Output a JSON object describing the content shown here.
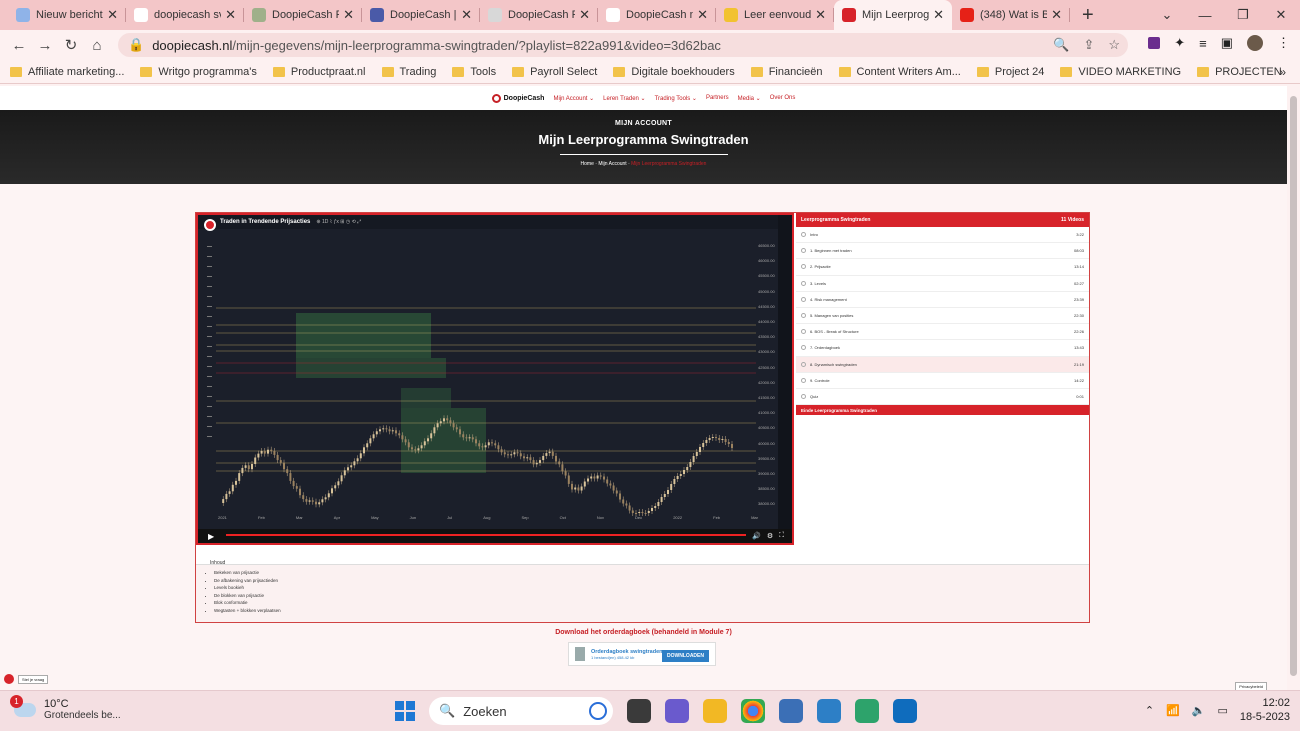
{
  "browser": {
    "tabs": [
      {
        "title": "Nieuw bericht",
        "fav": "#8fb3e8"
      },
      {
        "title": "doopiecash sv",
        "fav": "#ffffff"
      },
      {
        "title": "DoopieCash R",
        "fav": "#9fb08a"
      },
      {
        "title": "DoopieCash |",
        "fav": "#4a5aa8"
      },
      {
        "title": "DoopieCash R",
        "fav": "#d8d8d8"
      },
      {
        "title": "DoopieCash n",
        "fav": "#ffffff"
      },
      {
        "title": "Leer eenvoudi",
        "fav": "#f2c230"
      },
      {
        "title": "Mijn Leerprog",
        "fav": "#d7232a",
        "active": true
      },
      {
        "title": "(348) Wat is B",
        "fav": "#e62117"
      }
    ],
    "url_host": "doopiecash.nl",
    "url_path": "/mijn-gegevens/mijn-leerprogramma-swingtraden/?playlist=822a991&video=3d62bac",
    "bookmarks": [
      "Affiliate marketing...",
      "Writgo programma's",
      "Productpraat.nl",
      "Trading",
      "Tools",
      "Payroll Select",
      "Digitale boekhouders",
      "Financieën",
      "Content Writers Am...",
      "Project 24",
      "VIDEO MARKETING",
      "PROJECTEN"
    ]
  },
  "site": {
    "logo": "DoopieCash",
    "nav": [
      "Mijn Account ⌄",
      "Leren Traden ⌄",
      "Trading Tools ⌄",
      "Partners",
      "Media ⌄",
      "Over Ons"
    ],
    "hero_small": "MIJN ACCOUNT",
    "hero_title": "Mijn Leerprogramma Swingtraden",
    "crumb_home": "Home",
    "crumb_account": "Mijn Account",
    "crumb_current": "Mijn Leerprogramma Swingtraden"
  },
  "video": {
    "title": "Traden in Trendende Prijsacties",
    "y_ticks": [
      "46500.00",
      "46000.00",
      "45500.00",
      "45000.00",
      "44500.00",
      "44000.00",
      "43500.00",
      "43000.00",
      "42500.00",
      "42000.00",
      "41500.00",
      "41000.00",
      "40500.00",
      "40000.00",
      "39500.00",
      "39000.00",
      "38500.00",
      "38000.00"
    ],
    "x_ticks": [
      "2021",
      "Feb",
      "Mar",
      "Apr",
      "May",
      "Jun",
      "Jul",
      "Aug",
      "Sep",
      "Oct",
      "Nov",
      "Dec",
      "2022",
      "Feb",
      "Mar"
    ]
  },
  "playlist": {
    "title": "Leerprogramma Swingtraden",
    "count": "11 Videos",
    "items": [
      {
        "title": "Intro",
        "time": "3:22"
      },
      {
        "title": "1. Beginnen met traden",
        "time": "08:03"
      },
      {
        "title": "2. Prijsactie",
        "time": "13:14"
      },
      {
        "title": "3. Levels",
        "time": "02:27"
      },
      {
        "title": "4. Risk management",
        "time": "23:39"
      },
      {
        "title": "5. Managen van posities",
        "time": "22:30"
      },
      {
        "title": "6. BOS - Break of Structure",
        "time": "22:26"
      },
      {
        "title": "7. Orderdagboek",
        "time": "13:43"
      },
      {
        "title": "8. Dynamisch swingtraden",
        "time": "21:19",
        "active": true
      },
      {
        "title": "9. Controle",
        "time": "14:22"
      },
      {
        "title": "Quiz",
        "time": "0:01"
      }
    ],
    "footer": "Einde Leerprogramma Swingtraden"
  },
  "inhoud": {
    "tab": "Inhoud",
    "items": [
      "Bekeken van prijsactie",
      "De afbakening van prijsactieden",
      "Levels bookieh",
      "De blokken van prijsactie",
      "Blok conformatie",
      "Wegtasten + blokken verplaatsen"
    ]
  },
  "download": {
    "heading": "Download het orderdagboek (behandeld in Module 7)",
    "card_title": "Orderdagboek swingtraden",
    "card_meta": "1 bestand(en)   458.42 kb",
    "button": "DOWNLOADEN"
  },
  "help": "Stel je vraag",
  "privacy": "Privacybeleid",
  "taskbar": {
    "temp": "10°C",
    "weather": "Grotendeels be...",
    "weather_badge": "1",
    "search": "Zoeken",
    "time": "12:02",
    "date": "18-5-2023"
  }
}
